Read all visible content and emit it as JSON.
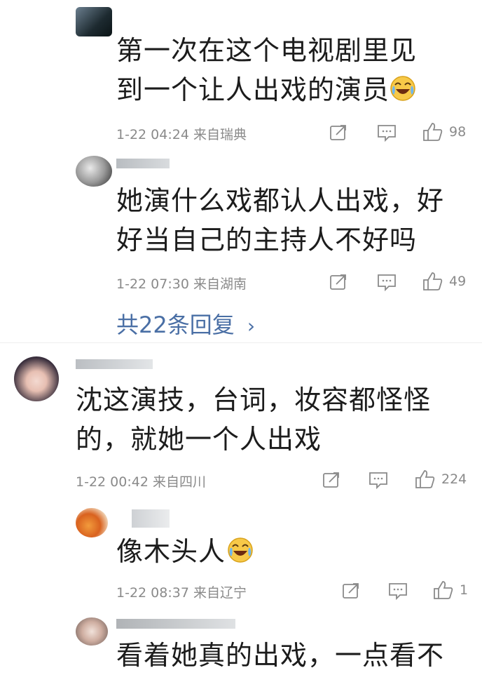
{
  "comments": [
    {
      "text_line1": "第一次在这个电视剧里见",
      "text_line2": "到一个让人出戏的演员",
      "emoji": "laugh-cry-emoji",
      "meta": "1-22 04:24 来自瑞典",
      "likes": "98"
    },
    {
      "text_line1": "她演什么戏都认人出戏，好",
      "text_line2": "好当自己的主持人不好吗",
      "meta": "1-22 07:30 来自湖南",
      "likes": "49"
    },
    {
      "replies_label": "共22条回复",
      "chevron": "›"
    },
    {
      "text_line1": "沈这演技，台词，妆容都怪怪",
      "text_line2": "的，就她一个人出戏",
      "meta": "1-22 00:42 来自四川",
      "likes": "224"
    },
    {
      "text_line1": "像木头人",
      "emoji": "laugh-cry-emoji",
      "meta": "1-22 08:37 来自辽宁",
      "likes": "1"
    },
    {
      "text_line1": "看着她真的出戏，一点看不"
    }
  ],
  "colors": {
    "link": "#4a6fa5",
    "meta": "#8a8a8a",
    "text": "#1c1c1c"
  }
}
